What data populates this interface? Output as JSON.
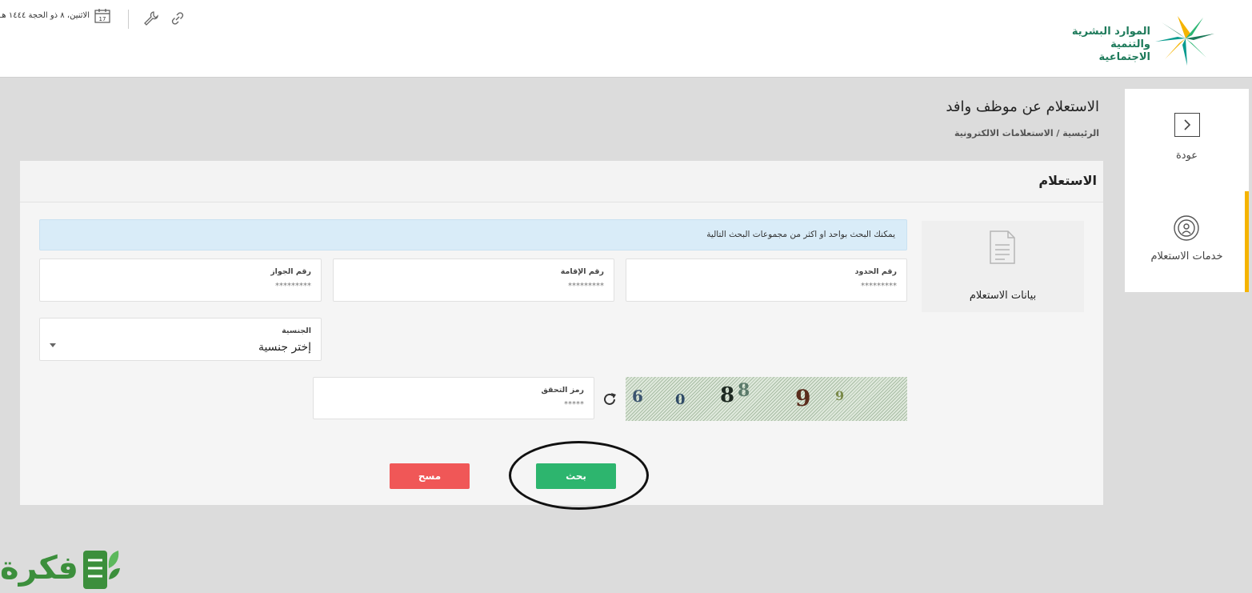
{
  "header": {
    "logo_text_line1": "الموارد البشرية",
    "logo_text_line2": "والتنمية الاجتماعية",
    "date": "الاثنين، ٨ ذو الحجة ١٤٤٤ هـ",
    "calendar_day": "17",
    "colors": {
      "logo_green": "#1d7a5a",
      "logo_yellow": "#f5b400",
      "logo_teal": "#0a9b8f"
    }
  },
  "sidebar": {
    "back_label": "عودة",
    "services_label": "خدمات الاستعلام",
    "accent_color": "#f5b400"
  },
  "page": {
    "title": "الاستعلام عن موظف وافد",
    "breadcrumb": "الرئيسية / الاستعلامات الالكترونية"
  },
  "card": {
    "title": "الاستعلام",
    "info_label": "بيانات الاستعلام",
    "alert": "يمكنك البحث بواحد او اكثر من مجموعات البحث التالية",
    "fields": {
      "border_number": {
        "label": "رقم الحدود",
        "placeholder": "*********"
      },
      "iqama_number": {
        "label": "رقم الإقامة",
        "placeholder": "*********"
      },
      "passport_number": {
        "label": "رقم الجواز",
        "placeholder": "*********"
      },
      "nationality": {
        "label": "الجنسية",
        "value": "إختر جنسية"
      },
      "captcha_code": {
        "label": "رمز التحقق",
        "placeholder": "*****"
      }
    },
    "captcha_chars": [
      "6",
      "0",
      "8",
      "8",
      "9",
      "9"
    ],
    "buttons": {
      "search": "بحث",
      "clear": "مسح"
    },
    "colors": {
      "search": "#2db56e",
      "clear": "#f05757"
    }
  },
  "watermark": {
    "text": "فكرة",
    "color": "#3c8f3c"
  }
}
